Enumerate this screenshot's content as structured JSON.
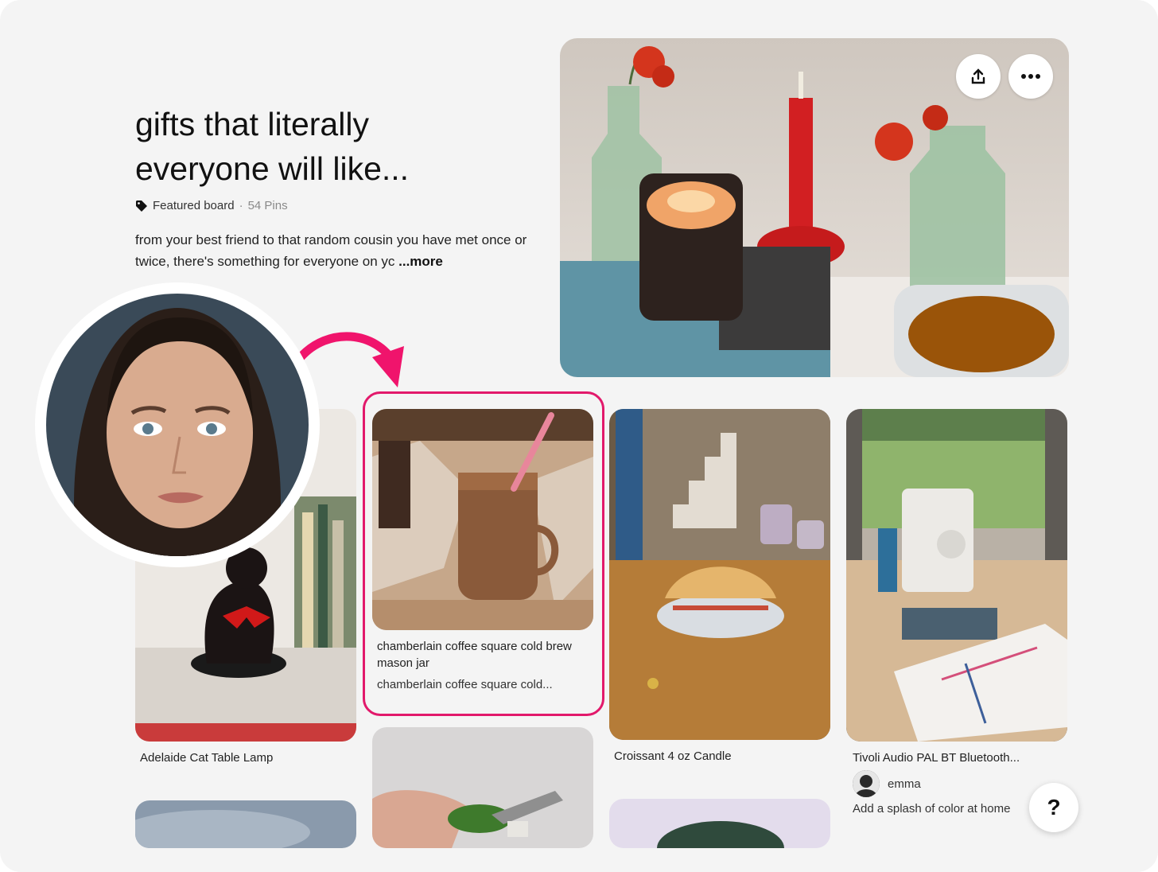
{
  "board": {
    "title": "gifts that literally everyone will like...",
    "featured_label": "Featured board",
    "separator": "·",
    "pin_count": "54 Pins",
    "description": "from your best friend to that random cousin you have met once or twice, there's something for everyone on yc",
    "more_label": "...more"
  },
  "hero": {
    "share_icon": "share-icon",
    "more_icon": "more-icon"
  },
  "pins": [
    {
      "title": "Adelaide Cat Table Lamp"
    },
    {
      "title": "chamberlain coffee square cold brew mason jar",
      "subtitle": "chamberlain coffee square cold..."
    },
    {
      "title": "Croissant 4 oz Candle"
    },
    {
      "title": "Tivoli Audio PAL BT Bluetooth...",
      "user": "emma",
      "note": "Add a splash of color at home"
    }
  ],
  "help": {
    "label": "?"
  },
  "colors": {
    "highlight": "#e2196b",
    "background": "#f4f4f4"
  }
}
